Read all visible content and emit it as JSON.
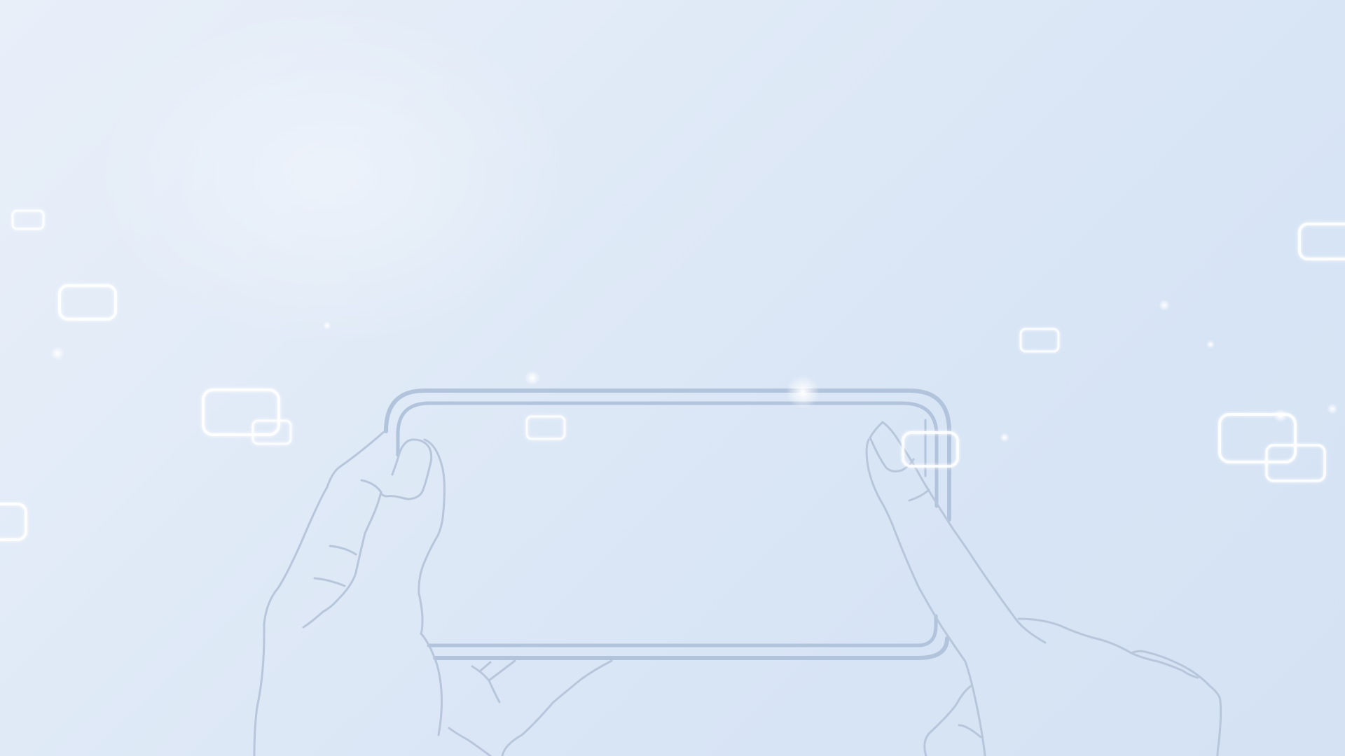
{
  "scene": {
    "background_colors": [
      "#e9eff9",
      "#d4e2f4"
    ],
    "line_color": "#b2c3dc",
    "glow_color": "#ffffff",
    "illustration": "hands-holding-phone-landscape",
    "decorations": "floating-glowing-rounded-rectangles-and-sparkles"
  }
}
